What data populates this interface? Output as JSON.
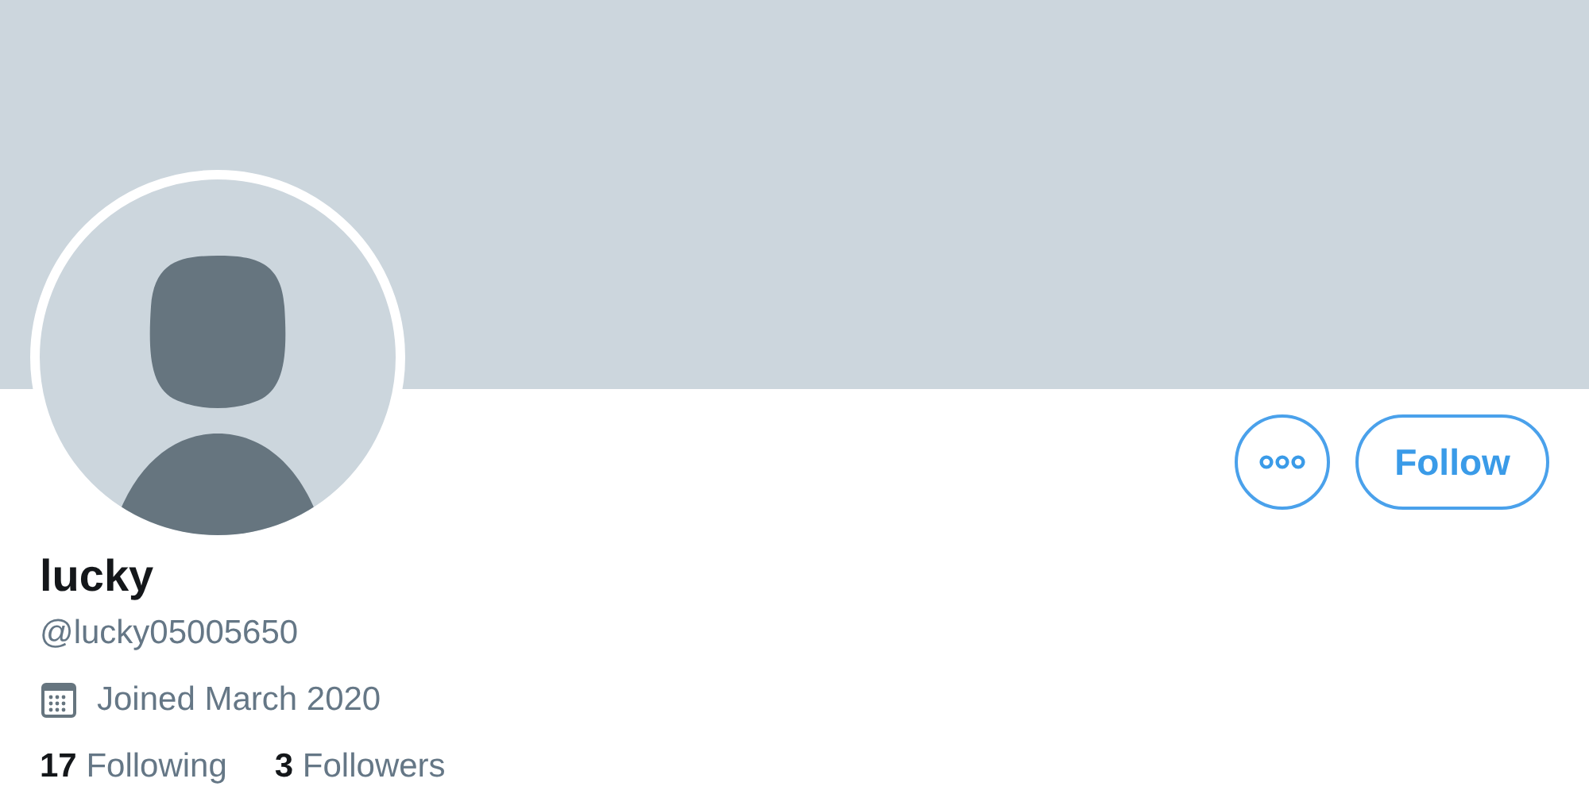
{
  "profile": {
    "name": "lucky",
    "handle": "@lucky05005650",
    "joined": "Joined March 2020"
  },
  "buttons": {
    "follow": "Follow"
  },
  "stats": [
    {
      "count": "17",
      "label": "Following"
    },
    {
      "count": "3",
      "label": "Followers"
    }
  ]
}
